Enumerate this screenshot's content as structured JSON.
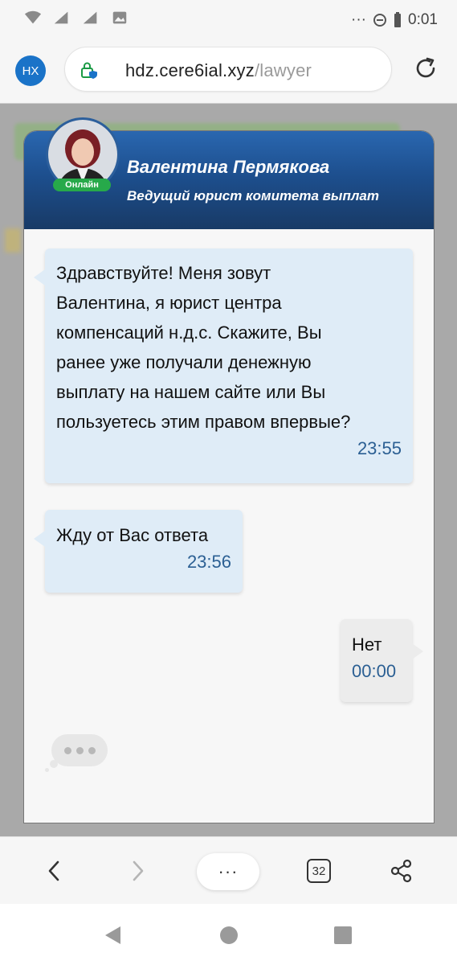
{
  "status_bar": {
    "time": "0:01",
    "dots": "···"
  },
  "browser": {
    "profile_initials": "НХ",
    "url_domain": "hdz.cere6ial.xyz",
    "url_path": "/lawyer"
  },
  "chat": {
    "name": "Валентина Пермякова",
    "role": "Ведущий юрист комитета выплат",
    "online_label": "Онлайн",
    "messages": [
      {
        "direction": "incoming",
        "lines": [
          "Здравствуйте! Меня зовут",
          "Валентина, я юрист центра",
          "компенсаций н.д.с. Скажите, Вы",
          "ранее уже получали денежную",
          "выплату на нашем сайте или Вы",
          "пользуетесь этим правом впервые?"
        ],
        "time": "23:55"
      },
      {
        "direction": "incoming",
        "text": "Жду от Вас ответа",
        "time": "23:56"
      },
      {
        "direction": "outgoing",
        "text": "Нет",
        "time": "00:00"
      }
    ]
  },
  "bottom_bar": {
    "menu_label": "···",
    "tabs_count": "32"
  },
  "icons": {
    "wifi": "wifi-icon",
    "signal": "signal-icon",
    "image": "image-icon",
    "dnd": "do-not-disturb-icon",
    "battery": "battery-icon",
    "lock": "lock-shield-icon",
    "reload": "reload-icon",
    "back": "chevron-left-icon",
    "forward": "chevron-right-icon",
    "share": "share-icon"
  },
  "colors": {
    "header_gradient_top": "#2a67b0",
    "header_gradient_bottom": "#183a66",
    "incoming_bubble": "#dfecf7",
    "outgoing_bubble": "#ececec",
    "time_text": "#2b5f93",
    "online_badge": "#27a94a"
  }
}
